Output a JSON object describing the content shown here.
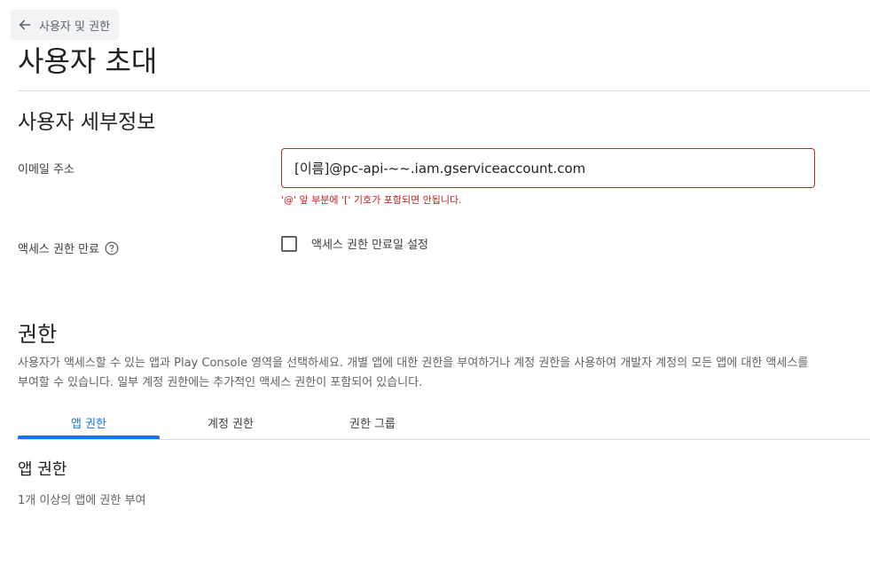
{
  "header": {
    "back_label": "사용자 및 권한",
    "back_icon": "arrow-left-icon",
    "title": "사용자 초대"
  },
  "details": {
    "section_title": "사용자 세부정보",
    "email_label": "이메일 주소",
    "email_value": "[이름]@pc-api-~~.iam.gserviceaccount.com",
    "email_error": "'@' 앞 부분에 '[' 기호가 포함되면 안됩니다.",
    "expiry_label": "액세스 권한 만료",
    "expiry_help_icon": "help-circle-icon",
    "expiry_checkbox_label": "액세스 권한 만료일 설정",
    "expiry_checked": false
  },
  "permissions": {
    "section_title": "권한",
    "description": "사용자가 액세스할 수 있는 앱과 Play Console 영역을 선택하세요. 개별 앱에 대한 권한을 부여하거나 계정 권한을 사용하여 개발자 계정의 모든 앱에 대한 액세스를 부여할 수 있습니다. 일부 계정 권한에는 추가적인 액세스 권한이 포함되어 있습니다.",
    "tabs": [
      {
        "label": "앱 권한",
        "active": true
      },
      {
        "label": "계정 권한",
        "active": false
      },
      {
        "label": "권한 그룹",
        "active": false
      }
    ],
    "app_permissions_title": "앱 권한",
    "app_permissions_desc": "1개 이상의 앱에 권한 부여"
  },
  "colors": {
    "accent": "#1a73e8",
    "error": "#c5221f",
    "divider": "#dadce0"
  }
}
